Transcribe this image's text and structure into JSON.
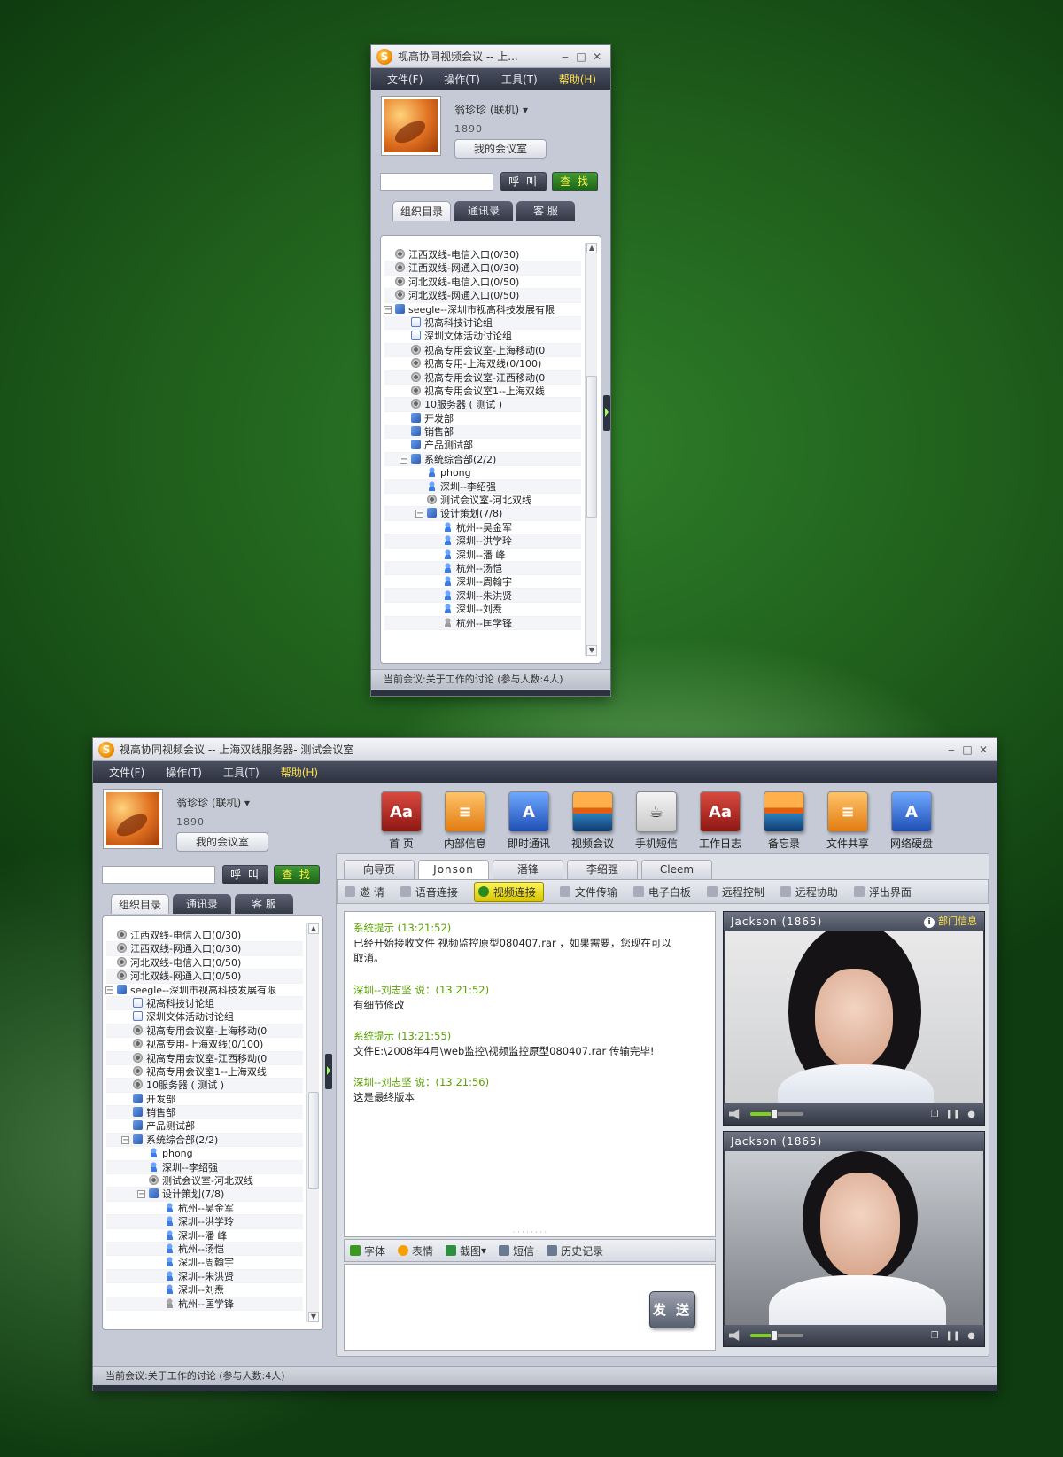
{
  "app_title_short": "视高协同视频会议 -- 上...",
  "app_title_full": "视高协同视频会议 -- 上海双线服务器- 测试会议室",
  "window_controls": {
    "min": "‒",
    "max": "□",
    "close": "✕"
  },
  "menu": [
    "文件(F)",
    "操作(T)",
    "工具(T)",
    "帮助(H)"
  ],
  "user": {
    "name": "翁珍珍 (联机)",
    "id": "1890",
    "room_button": "我的会议室"
  },
  "search": {
    "placeholder": "",
    "call": "呼 叫",
    "find": "查 找"
  },
  "left_tabs": [
    "组织目录",
    "通讯录",
    "客 服"
  ],
  "tree": [
    {
      "label": "江西双线-电信入口(0/30)",
      "icon": "conf",
      "level": 1
    },
    {
      "label": "江西双线-网通入口(0/30)",
      "icon": "conf",
      "level": 1
    },
    {
      "label": "河北双线-电信入口(0/50)",
      "icon": "conf",
      "level": 1
    },
    {
      "label": "河北双线-网通入口(0/50)",
      "icon": "conf",
      "level": 1
    },
    {
      "label": "seegle--深圳市视高科技发展有限",
      "icon": "grp",
      "level": 1,
      "expanded": true
    },
    {
      "label": "视高科技讨论组",
      "icon": "doc",
      "level": 2
    },
    {
      "label": "深圳文体活动讨论组",
      "icon": "doc",
      "level": 2
    },
    {
      "label": "视高专用会议室-上海移动(0",
      "icon": "conf",
      "level": 2
    },
    {
      "label": "视高专用-上海双线(0/100)",
      "icon": "conf",
      "level": 2
    },
    {
      "label": "视高专用会议室-江西移动(0",
      "icon": "conf",
      "level": 2
    },
    {
      "label": "视高专用会议室1--上海双线",
      "icon": "conf",
      "level": 2
    },
    {
      "label": "10服务器 ( 测试 )",
      "icon": "conf",
      "level": 2
    },
    {
      "label": "开发部",
      "icon": "grp",
      "level": 2
    },
    {
      "label": "销售部",
      "icon": "grp",
      "level": 2
    },
    {
      "label": "产品测试部",
      "icon": "grp",
      "level": 2
    },
    {
      "label": "系统综合部(2/2)",
      "icon": "grp",
      "level": 2,
      "expanded": true
    },
    {
      "label": "phong",
      "icon": "user",
      "level": 3
    },
    {
      "label": "深圳--李绍强",
      "icon": "user",
      "level": 3
    },
    {
      "label": "测试会议室-河北双线",
      "icon": "conf",
      "level": 3
    },
    {
      "label": "设计策划(7/8)",
      "icon": "grp",
      "level": 3,
      "expanded": true
    },
    {
      "label": "杭州--吴金军",
      "icon": "user",
      "level": 4
    },
    {
      "label": "深圳--洪学玲",
      "icon": "user",
      "level": 4
    },
    {
      "label": "深圳--潘 峰",
      "icon": "user",
      "level": 4
    },
    {
      "label": "杭州--汤恺",
      "icon": "user",
      "level": 4
    },
    {
      "label": "深圳--周翰宇",
      "icon": "user",
      "level": 4
    },
    {
      "label": "深圳--朱洪贤",
      "icon": "user",
      "level": 4
    },
    {
      "label": "深圳--刘焘",
      "icon": "user",
      "level": 4
    },
    {
      "label": "杭州--匡学锋",
      "icon": "off",
      "level": 4
    }
  ],
  "status_text": "当前会议:关于工作的讨论 (参与人数:4人)",
  "toolbar": [
    {
      "label": "首 页",
      "icon": "book-icon",
      "glyph": "Aa",
      "cls": "book"
    },
    {
      "label": "内部信息",
      "icon": "document-icon",
      "glyph": "≡",
      "cls": "ora"
    },
    {
      "label": "即时通讯",
      "icon": "app-icon",
      "glyph": "A",
      "cls": "blu"
    },
    {
      "label": "视频会议",
      "icon": "photo-icon",
      "glyph": "",
      "cls": "pho"
    },
    {
      "label": "手机短信",
      "icon": "coffee-icon",
      "glyph": "☕",
      "cls": "cup"
    },
    {
      "label": "工作日志",
      "icon": "book-icon",
      "glyph": "Aa",
      "cls": "book"
    },
    {
      "label": "备忘录",
      "icon": "photo-icon",
      "glyph": "",
      "cls": "pho"
    },
    {
      "label": "文件共享",
      "icon": "document-icon",
      "glyph": "≡",
      "cls": "ora"
    },
    {
      "label": "网络硬盘",
      "icon": "app-icon",
      "glyph": "A",
      "cls": "blu"
    }
  ],
  "content_tabs": [
    "向导页",
    "Jonson",
    "潘锋",
    "李绍强",
    "Cleem"
  ],
  "actions": [
    "邀 请",
    "语音连接",
    "视频连接",
    "文件传输",
    "电子白板",
    "远程控制",
    "远程协助",
    "浮出界面"
  ],
  "messages": [
    {
      "who": "系统提示 (13:21:52)",
      "text": "已经开始接收文件 视频监控原型080407.rar ，如果需要，您现在可以取消。"
    },
    {
      "who": "深圳--刘志坚 说：(13:21:52)",
      "text": "有细节修改"
    },
    {
      "who": "系统提示 (13:21:55)",
      "text": "文件E:\\2008年4月\\web监控\\视频监控原型080407.rar 传输完毕!"
    },
    {
      "who": "深圳--刘志坚 说：(13:21:56)",
      "text": "这是最终版本"
    }
  ],
  "editor_tools": [
    "字体",
    "表情",
    "截图",
    "短信",
    "历史记录"
  ],
  "send_label": "发 送",
  "videos": [
    {
      "name": "Jackson (1865)",
      "info": "部门信息",
      "volume": 0.45
    },
    {
      "name": "Jackson (1865)",
      "info": "",
      "volume": 0.45
    }
  ],
  "colors": {
    "accent_green": "#5aa000",
    "menu_highlight": "#ffe24a",
    "menu_bg": "#2d3240"
  }
}
